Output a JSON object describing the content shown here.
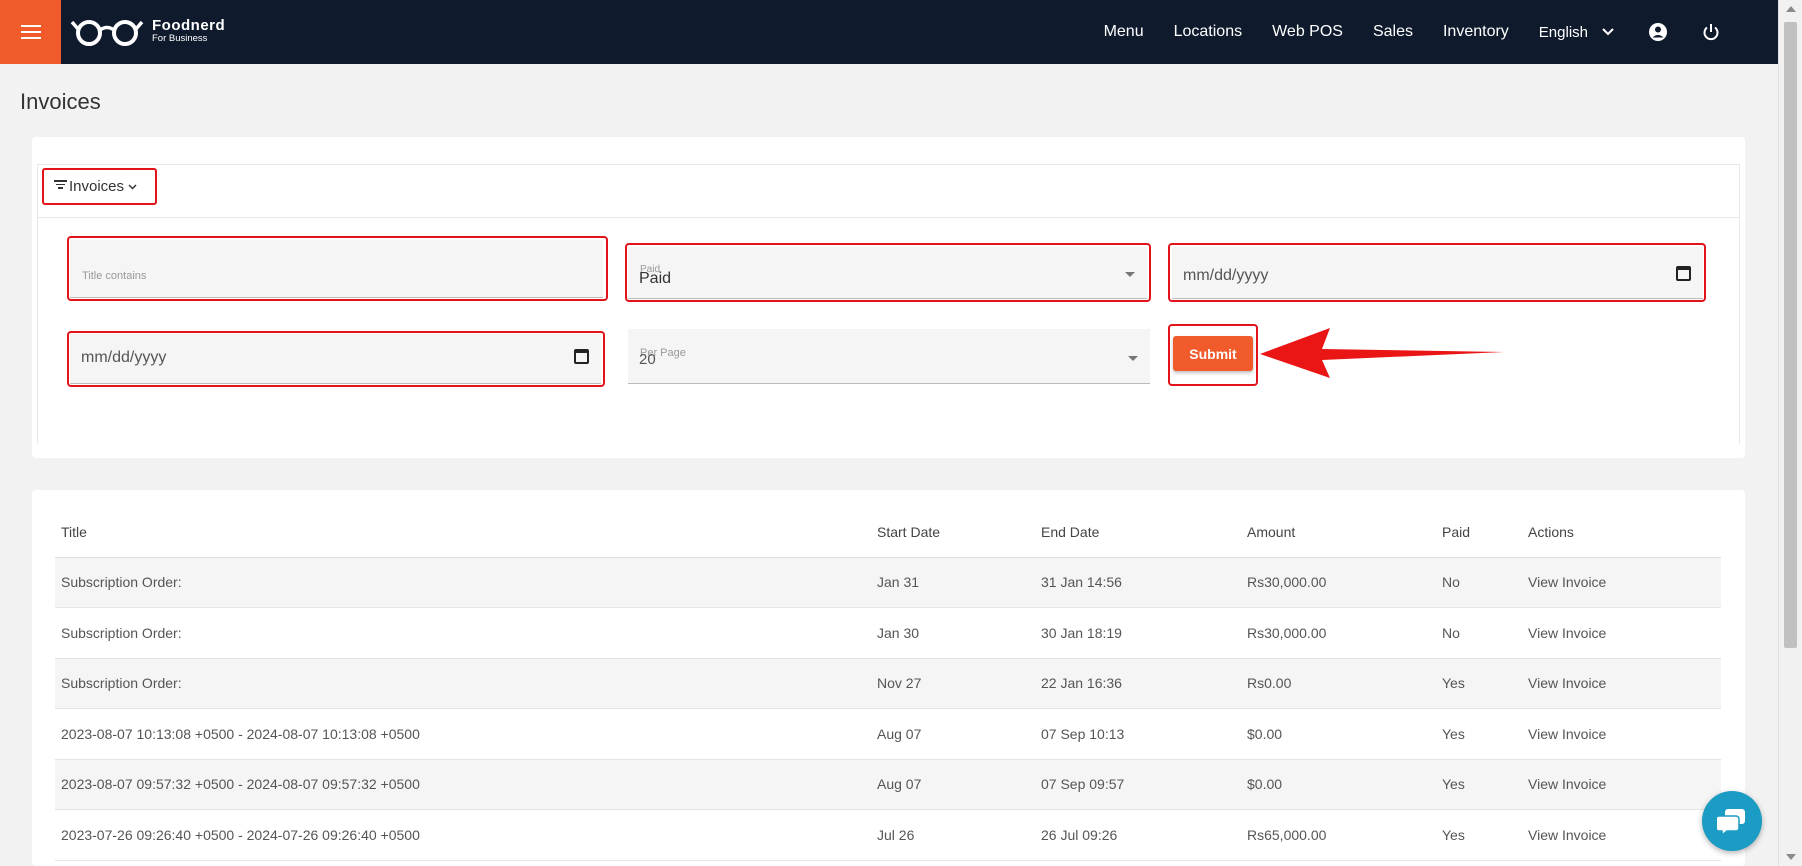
{
  "header": {
    "logo_name": "Foodnerd",
    "logo_sub": "For Business",
    "nav": [
      "Menu",
      "Locations",
      "Web POS",
      "Sales",
      "Inventory"
    ],
    "language": "English",
    "accent_color": "#f15a2b",
    "bg_color": "#0f1b2d"
  },
  "page": {
    "title": "Invoices"
  },
  "filters": {
    "toggle_label": "Invoices",
    "title_label": "Title contains",
    "paid_label": "Paid",
    "paid_value": "Paid",
    "start_date_placeholder": "mm/dd/yyyy",
    "end_date_placeholder": "mm/dd/yyyy",
    "per_page_label": "Per Page",
    "per_page_value": "20",
    "submit_label": "Submit"
  },
  "table": {
    "columns": [
      "Title",
      "Start Date",
      "End Date",
      "Amount",
      "Paid",
      "Actions"
    ],
    "rows": [
      {
        "title": "Subscription Order:",
        "start": "Jan 31",
        "end": "31 Jan 14:56",
        "amount": "Rs30,000.00",
        "paid": "No",
        "action": "View Invoice"
      },
      {
        "title": "Subscription Order:",
        "start": "Jan 30",
        "end": "30 Jan 18:19",
        "amount": "Rs30,000.00",
        "paid": "No",
        "action": "View Invoice"
      },
      {
        "title": "Subscription Order:",
        "start": "Nov 27",
        "end": "22 Jan 16:36",
        "amount": "Rs0.00",
        "paid": "Yes",
        "action": "View Invoice"
      },
      {
        "title": "2023-08-07 10:13:08 +0500 - 2024-08-07 10:13:08 +0500",
        "start": "Aug 07",
        "end": "07 Sep 10:13",
        "amount": "$0.00",
        "paid": "Yes",
        "action": "View Invoice"
      },
      {
        "title": "2023-08-07 09:57:32 +0500 - 2024-08-07 09:57:32 +0500",
        "start": "Aug 07",
        "end": "07 Sep 09:57",
        "amount": "$0.00",
        "paid": "Yes",
        "action": "View Invoice"
      },
      {
        "title": "2023-07-26 09:26:40 +0500 - 2024-07-26 09:26:40 +0500",
        "start": "Jul 26",
        "end": "26 Jul 09:26",
        "amount": "Rs65,000.00",
        "paid": "Yes",
        "action": "View Invoice"
      }
    ]
  },
  "icons": {
    "menu": "hamburger-icon",
    "logo": "glasses-icon",
    "language_dropdown": "chevron-down-icon",
    "account": "account-circle-icon",
    "power": "power-icon",
    "filter": "filter-icon",
    "calendar": "calendar-icon",
    "chat": "chat-icon",
    "annotation": "red-arrow-icon"
  }
}
